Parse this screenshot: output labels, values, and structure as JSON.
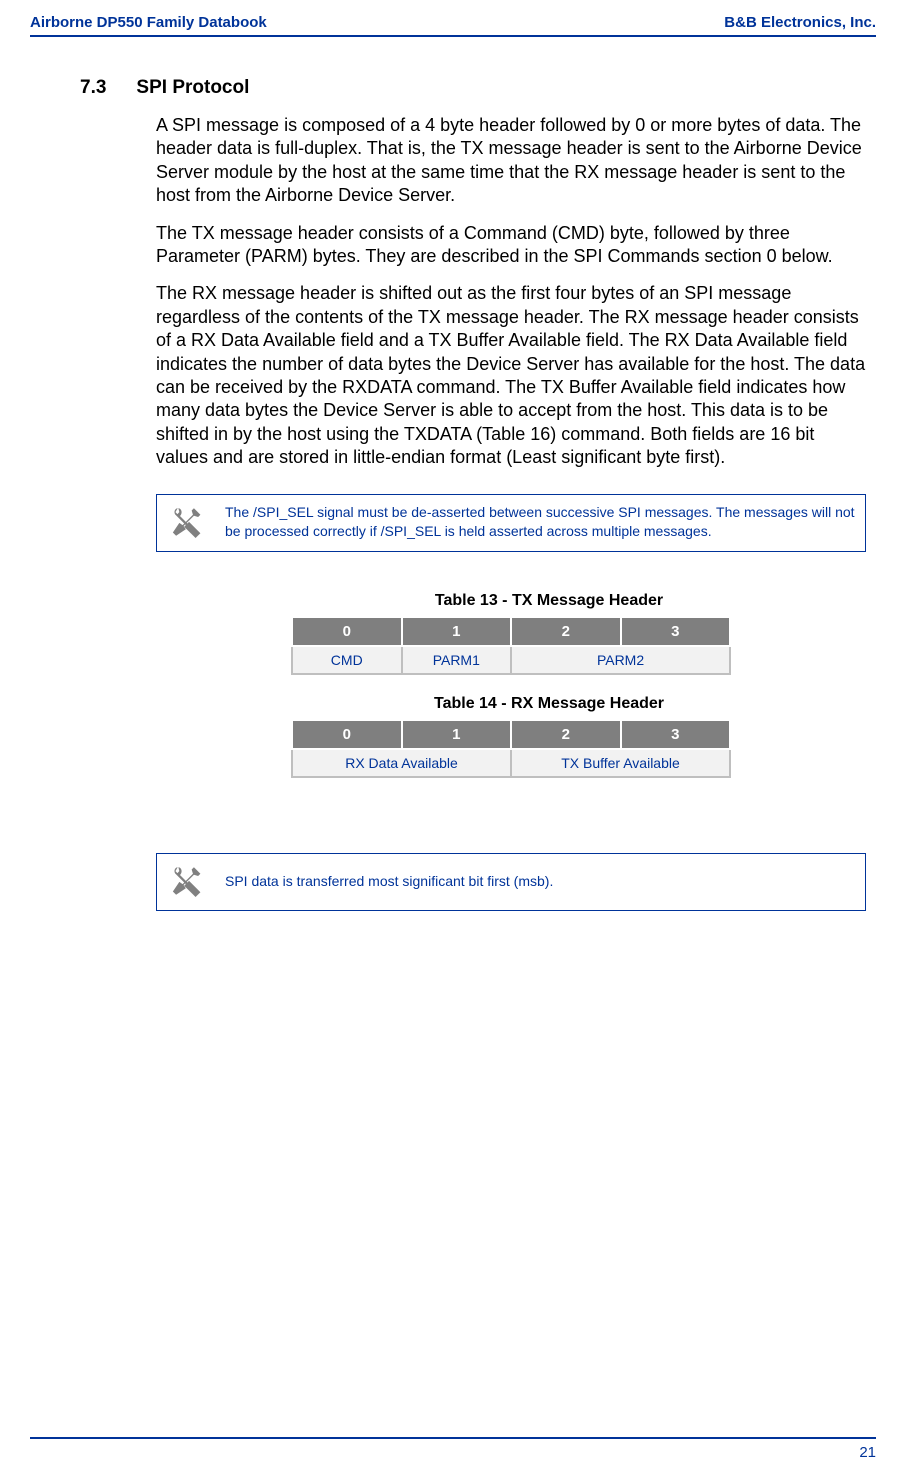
{
  "header": {
    "left": "Airborne DP550 Family Databook",
    "right": "B&B Electronics, Inc."
  },
  "section": {
    "number": "7.3",
    "title": "SPI Protocol"
  },
  "paragraphs": {
    "p1": "A SPI message is composed of a 4 byte header followed by 0 or more bytes of data.  The header data is full-duplex.  That is, the TX message header is sent to the Airborne Device Server module by the host at the same time that the RX message header is sent to the host from the Airborne Device Server.",
    "p2": "The TX message header consists of a Command (CMD) byte, followed by three Parameter (PARM) bytes.  They are described in the SPI Commands section 0 below.",
    "p3": "The RX message header is shifted out as the first four bytes of an SPI message regardless of the contents of the TX message header.  The RX message header consists of a RX Data Available field and a TX Buffer Available field.  The RX Data Available field indicates the number of data bytes the Device Server has available for the host.  The data can be received by the RXDATA command.  The TX Buffer Available field indicates how many data bytes the Device Server is able to accept from the host.  This data is to be shifted in by the host using the TXDATA (Table 16) command.  Both fields are 16 bit values and are stored in little-endian format (Least significant byte first)."
  },
  "notes": {
    "note1": "The /SPI_SEL signal must be de-asserted between successive SPI messages.  The messages will not be processed correctly if /SPI_SEL is held asserted across multiple messages.",
    "note2": "SPI data is transferred most significant bit first (msb)."
  },
  "tables": {
    "table13": {
      "caption": "Table 13 - TX Message Header",
      "headers": [
        "0",
        "1",
        "2",
        "3"
      ],
      "cells": {
        "c0": "CMD",
        "c1": "PARM1",
        "c2": "PARM2"
      }
    },
    "table14": {
      "caption": "Table 14 - RX Message Header",
      "headers": [
        "0",
        "1",
        "2",
        "3"
      ],
      "cells": {
        "c0": "RX Data Available",
        "c1": "TX Buffer Available"
      }
    }
  },
  "footer": {
    "page": "21"
  }
}
